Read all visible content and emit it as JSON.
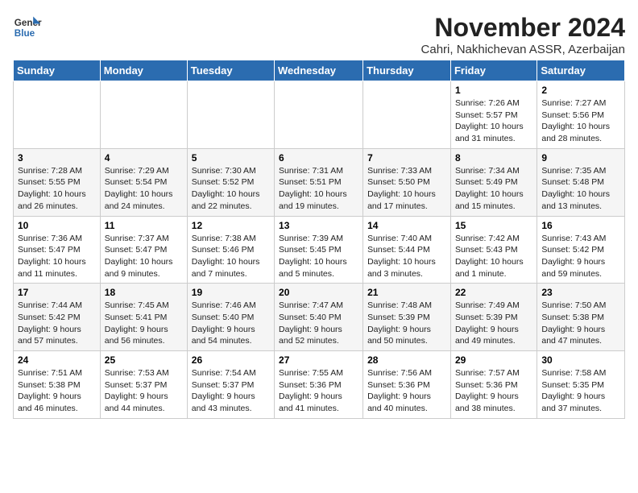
{
  "logo": {
    "line1": "General",
    "line2": "Blue"
  },
  "title": "November 2024",
  "location": "Cahri, Nakhichevan ASSR, Azerbaijan",
  "days_of_week": [
    "Sunday",
    "Monday",
    "Tuesday",
    "Wednesday",
    "Thursday",
    "Friday",
    "Saturday"
  ],
  "weeks": [
    [
      {
        "day": "",
        "info": ""
      },
      {
        "day": "",
        "info": ""
      },
      {
        "day": "",
        "info": ""
      },
      {
        "day": "",
        "info": ""
      },
      {
        "day": "",
        "info": ""
      },
      {
        "day": "1",
        "info": "Sunrise: 7:26 AM\nSunset: 5:57 PM\nDaylight: 10 hours\nand 31 minutes."
      },
      {
        "day": "2",
        "info": "Sunrise: 7:27 AM\nSunset: 5:56 PM\nDaylight: 10 hours\nand 28 minutes."
      }
    ],
    [
      {
        "day": "3",
        "info": "Sunrise: 7:28 AM\nSunset: 5:55 PM\nDaylight: 10 hours\nand 26 minutes."
      },
      {
        "day": "4",
        "info": "Sunrise: 7:29 AM\nSunset: 5:54 PM\nDaylight: 10 hours\nand 24 minutes."
      },
      {
        "day": "5",
        "info": "Sunrise: 7:30 AM\nSunset: 5:52 PM\nDaylight: 10 hours\nand 22 minutes."
      },
      {
        "day": "6",
        "info": "Sunrise: 7:31 AM\nSunset: 5:51 PM\nDaylight: 10 hours\nand 19 minutes."
      },
      {
        "day": "7",
        "info": "Sunrise: 7:33 AM\nSunset: 5:50 PM\nDaylight: 10 hours\nand 17 minutes."
      },
      {
        "day": "8",
        "info": "Sunrise: 7:34 AM\nSunset: 5:49 PM\nDaylight: 10 hours\nand 15 minutes."
      },
      {
        "day": "9",
        "info": "Sunrise: 7:35 AM\nSunset: 5:48 PM\nDaylight: 10 hours\nand 13 minutes."
      }
    ],
    [
      {
        "day": "10",
        "info": "Sunrise: 7:36 AM\nSunset: 5:47 PM\nDaylight: 10 hours\nand 11 minutes."
      },
      {
        "day": "11",
        "info": "Sunrise: 7:37 AM\nSunset: 5:47 PM\nDaylight: 10 hours\nand 9 minutes."
      },
      {
        "day": "12",
        "info": "Sunrise: 7:38 AM\nSunset: 5:46 PM\nDaylight: 10 hours\nand 7 minutes."
      },
      {
        "day": "13",
        "info": "Sunrise: 7:39 AM\nSunset: 5:45 PM\nDaylight: 10 hours\nand 5 minutes."
      },
      {
        "day": "14",
        "info": "Sunrise: 7:40 AM\nSunset: 5:44 PM\nDaylight: 10 hours\nand 3 minutes."
      },
      {
        "day": "15",
        "info": "Sunrise: 7:42 AM\nSunset: 5:43 PM\nDaylight: 10 hours\nand 1 minute."
      },
      {
        "day": "16",
        "info": "Sunrise: 7:43 AM\nSunset: 5:42 PM\nDaylight: 9 hours\nand 59 minutes."
      }
    ],
    [
      {
        "day": "17",
        "info": "Sunrise: 7:44 AM\nSunset: 5:42 PM\nDaylight: 9 hours\nand 57 minutes."
      },
      {
        "day": "18",
        "info": "Sunrise: 7:45 AM\nSunset: 5:41 PM\nDaylight: 9 hours\nand 56 minutes."
      },
      {
        "day": "19",
        "info": "Sunrise: 7:46 AM\nSunset: 5:40 PM\nDaylight: 9 hours\nand 54 minutes."
      },
      {
        "day": "20",
        "info": "Sunrise: 7:47 AM\nSunset: 5:40 PM\nDaylight: 9 hours\nand 52 minutes."
      },
      {
        "day": "21",
        "info": "Sunrise: 7:48 AM\nSunset: 5:39 PM\nDaylight: 9 hours\nand 50 minutes."
      },
      {
        "day": "22",
        "info": "Sunrise: 7:49 AM\nSunset: 5:39 PM\nDaylight: 9 hours\nand 49 minutes."
      },
      {
        "day": "23",
        "info": "Sunrise: 7:50 AM\nSunset: 5:38 PM\nDaylight: 9 hours\nand 47 minutes."
      }
    ],
    [
      {
        "day": "24",
        "info": "Sunrise: 7:51 AM\nSunset: 5:38 PM\nDaylight: 9 hours\nand 46 minutes."
      },
      {
        "day": "25",
        "info": "Sunrise: 7:53 AM\nSunset: 5:37 PM\nDaylight: 9 hours\nand 44 minutes."
      },
      {
        "day": "26",
        "info": "Sunrise: 7:54 AM\nSunset: 5:37 PM\nDaylight: 9 hours\nand 43 minutes."
      },
      {
        "day": "27",
        "info": "Sunrise: 7:55 AM\nSunset: 5:36 PM\nDaylight: 9 hours\nand 41 minutes."
      },
      {
        "day": "28",
        "info": "Sunrise: 7:56 AM\nSunset: 5:36 PM\nDaylight: 9 hours\nand 40 minutes."
      },
      {
        "day": "29",
        "info": "Sunrise: 7:57 AM\nSunset: 5:36 PM\nDaylight: 9 hours\nand 38 minutes."
      },
      {
        "day": "30",
        "info": "Sunrise: 7:58 AM\nSunset: 5:35 PM\nDaylight: 9 hours\nand 37 minutes."
      }
    ]
  ]
}
